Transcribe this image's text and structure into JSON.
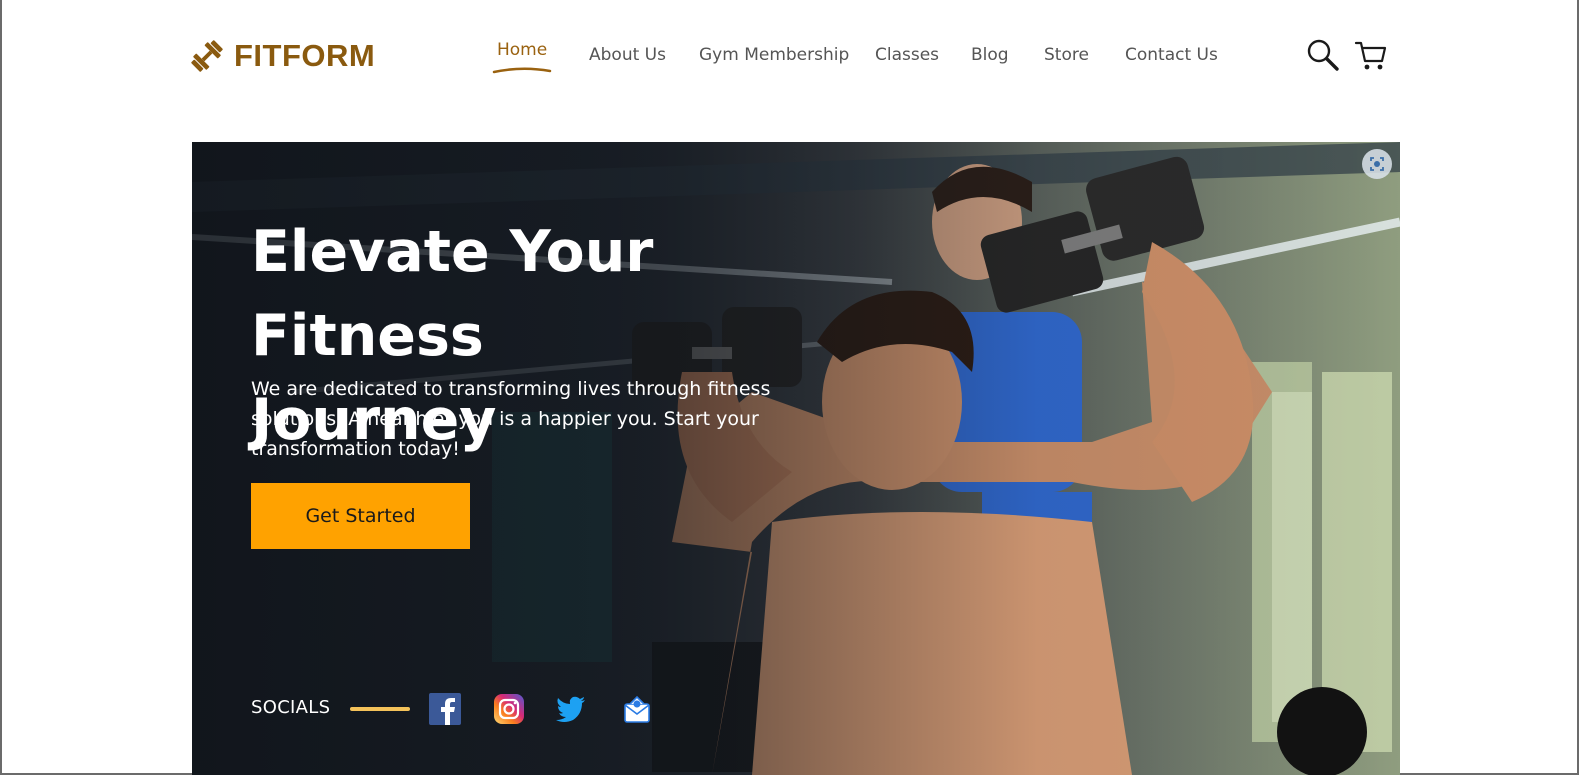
{
  "brand": {
    "name": "FITFORM"
  },
  "nav": {
    "items": [
      {
        "label": "Home",
        "active": true
      },
      {
        "label": "About Us"
      },
      {
        "label": "Gym Membership"
      },
      {
        "label": "Classes"
      },
      {
        "label": "Blog"
      },
      {
        "label": "Store"
      },
      {
        "label": "Contact Us"
      }
    ]
  },
  "header_icons": {
    "search": "search-icon",
    "cart": "cart-icon"
  },
  "hero": {
    "title_line1": "Elevate Your Fitness",
    "title_line2": "Journey",
    "subtitle": "We are dedicated to transforming lives through fitness solutions. A healthier you is a happier you. Start your transformation today!",
    "cta_label": "Get Started",
    "socials_label": "SOCIALS",
    "socials": [
      "facebook-icon",
      "instagram-icon",
      "twitter-icon",
      "email-icon"
    ],
    "image_lens_icon": "visual-search-icon"
  },
  "colors": {
    "brand": "#8a5a0f",
    "accent": "#ffa200",
    "nav_text": "#555555",
    "nav_active": "#9a6210"
  }
}
